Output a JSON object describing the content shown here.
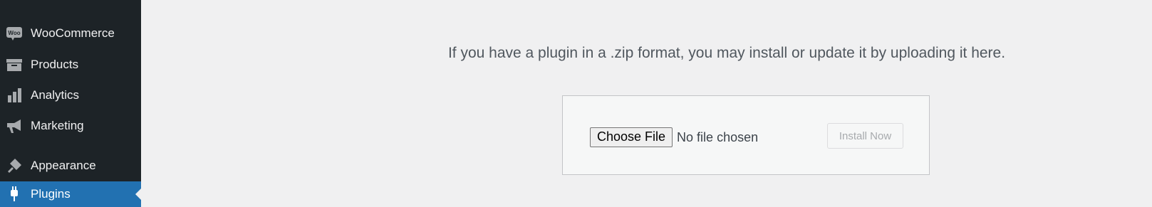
{
  "sidebar": {
    "items": [
      {
        "label": "WooCommerce",
        "icon": "woo-icon"
      },
      {
        "label": "Products",
        "icon": "archive-icon"
      },
      {
        "label": "Analytics",
        "icon": "bar-chart-icon"
      },
      {
        "label": "Marketing",
        "icon": "megaphone-icon"
      },
      {
        "label": "Appearance",
        "icon": "paintbrush-icon"
      },
      {
        "label": "Plugins",
        "icon": "plug-icon"
      }
    ],
    "active_color": "#2271b1",
    "background": "#1d2327"
  },
  "main": {
    "intro_text": "If you have a plugin in a .zip format, you may install or update it by uploading it here.",
    "upload": {
      "choose_file_label": "Choose File",
      "file_status": "No file chosen",
      "install_label": "Install Now"
    }
  }
}
